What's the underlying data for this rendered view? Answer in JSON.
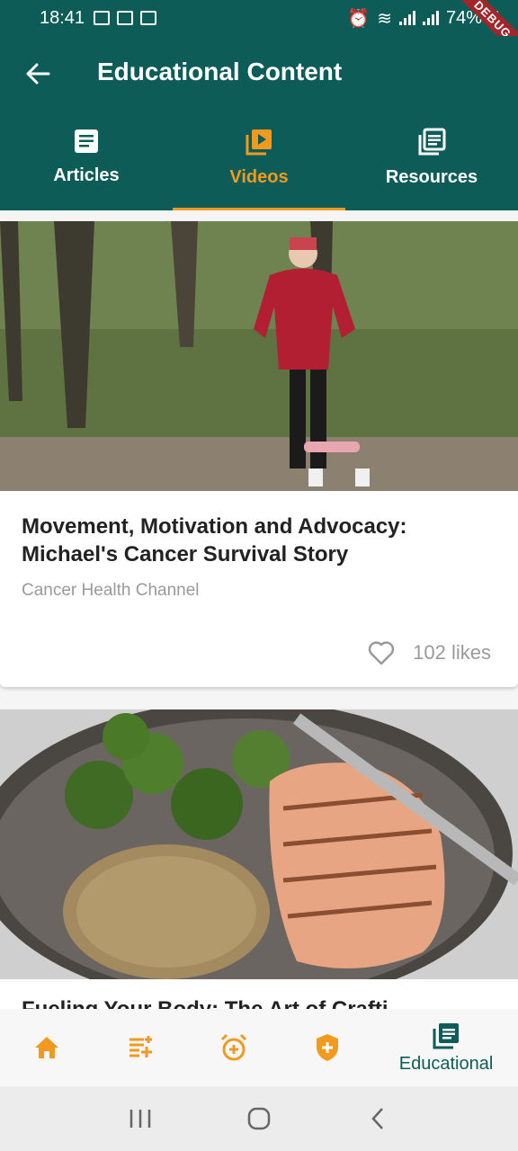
{
  "status_bar": {
    "time": "18:41",
    "battery": "74%",
    "debug_label": "DEBUG"
  },
  "app_bar": {
    "title": "Educational Content",
    "back_icon": "arrow-left-icon"
  },
  "tabs": [
    {
      "label": "Articles",
      "icon": "article-icon",
      "active": false
    },
    {
      "label": "Videos",
      "icon": "video-library-icon",
      "active": true
    },
    {
      "label": "Resources",
      "icon": "library-books-icon",
      "active": false
    }
  ],
  "cards": [
    {
      "title": "Movement, Motivation and Advocacy: Michael's Cancer Survival Story",
      "source": "Cancer Health Channel",
      "likes": "102 likes"
    },
    {
      "title": "Fueling Your Body: The Art of Crafti..."
    }
  ],
  "bottom_nav": {
    "items": [
      {
        "icon": "home-icon"
      },
      {
        "icon": "note-add-icon"
      },
      {
        "icon": "alarm-add-icon"
      },
      {
        "icon": "shield-plus-icon"
      },
      {
        "icon": "library-books-icon",
        "label": "Educational"
      }
    ]
  },
  "colors": {
    "primary": "#0d5c58",
    "accent": "#f29a1f",
    "muted": "#9a9a9a"
  }
}
